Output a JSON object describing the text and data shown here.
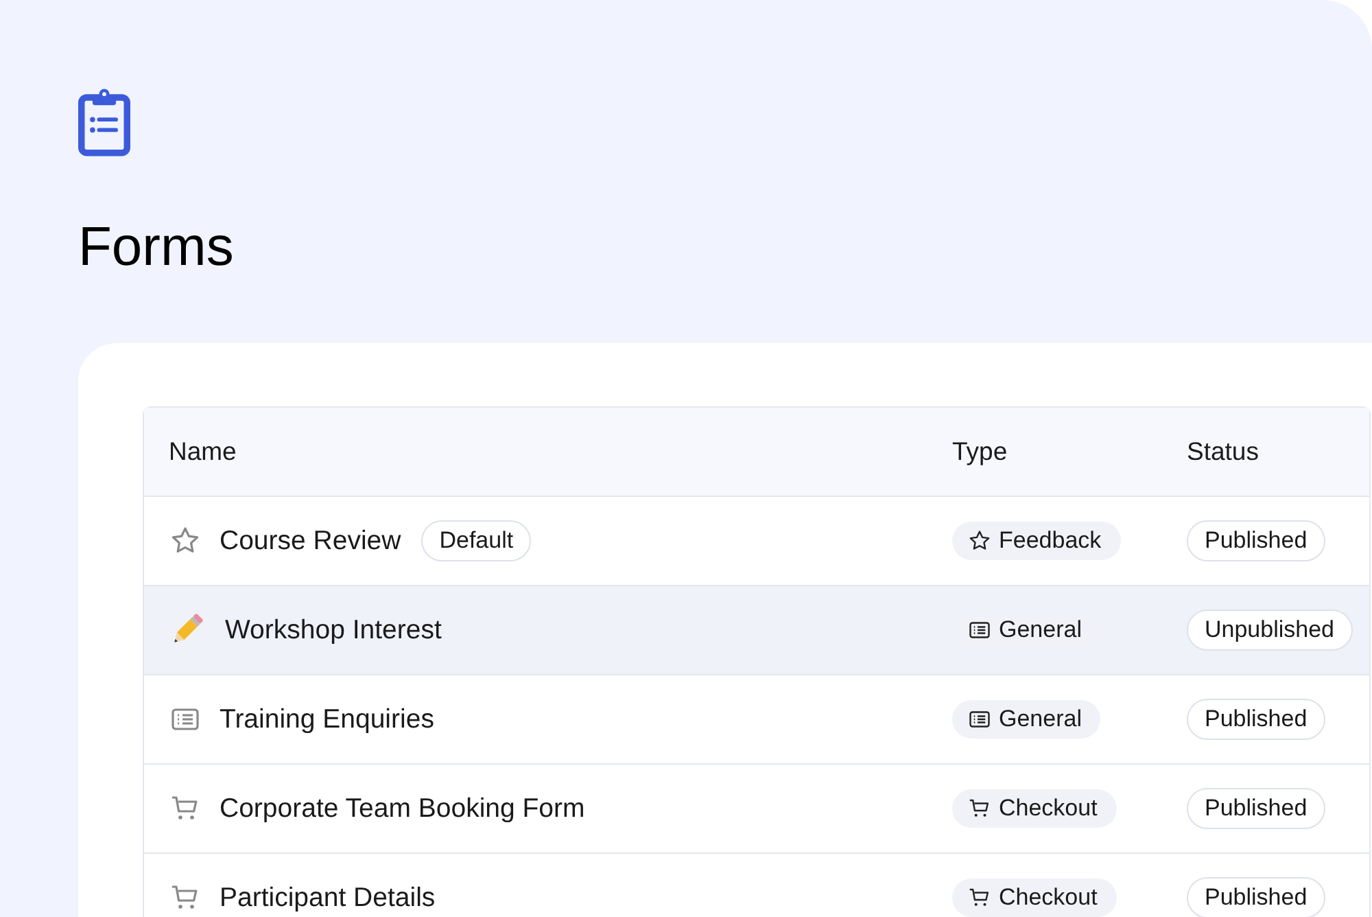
{
  "page": {
    "title": "Forms"
  },
  "table": {
    "columns": [
      "Name",
      "Type",
      "Status"
    ],
    "rows": [
      {
        "name": "Course Review",
        "kind": "star",
        "badge": "Default",
        "hovered": false,
        "type": {
          "label": "Feedback",
          "kind": "star"
        },
        "status": "Published"
      },
      {
        "name": "Workshop Interest",
        "kind": "pencil",
        "hovered": true,
        "type": {
          "label": "General",
          "kind": "list"
        },
        "status": "Unpublished"
      },
      {
        "name": "Training Enquiries",
        "kind": "list",
        "hovered": false,
        "type": {
          "label": "General",
          "kind": "list"
        },
        "status": "Published"
      },
      {
        "name": "Corporate Team Booking Form",
        "kind": "cart",
        "hovered": false,
        "type": {
          "label": "Checkout",
          "kind": "cart"
        },
        "status": "Published"
      },
      {
        "name": "Participant Details",
        "kind": "cart",
        "hovered": false,
        "type": {
          "label": "Checkout",
          "kind": "cart"
        },
        "status": "Published"
      }
    ]
  }
}
